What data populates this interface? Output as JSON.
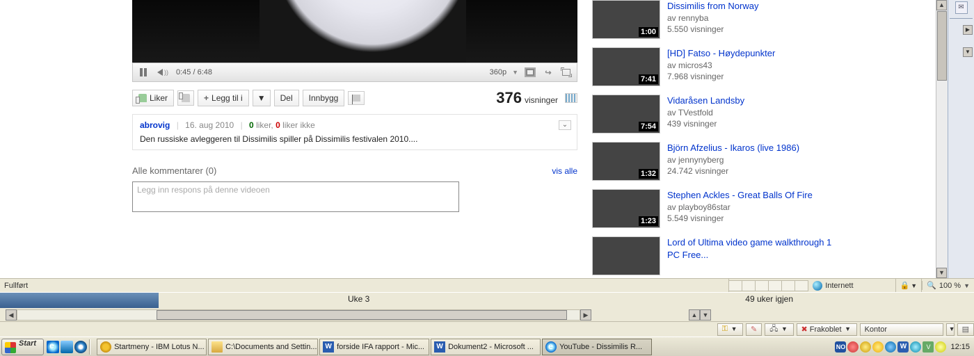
{
  "player": {
    "time": "0:45 / 6:48",
    "quality": "360p"
  },
  "actions": {
    "like": "Liker",
    "add": "Legg til i",
    "share": "Del",
    "embed": "Innbygg"
  },
  "views": {
    "count": "376",
    "label": "visninger"
  },
  "description": {
    "uploader": "abrovig",
    "date": "16. aug 2010",
    "likes_n": "0",
    "likes_lbl": "liker,",
    "dislikes_n": "0",
    "dislikes_lbl": "liker ikke",
    "text": "Den russiske avleggeren til Dissimilis spiller på Dissimilis festivalen 2010...."
  },
  "comments": {
    "header": "Alle kommentarer (0)",
    "showall": "vis alle",
    "placeholder": "Legg inn respons på denne videoen"
  },
  "related": [
    {
      "title": "Dissimilis from Norway",
      "by": "av rennyba",
      "views": "5.550 visninger",
      "dur": "1:00"
    },
    {
      "title": "[HD] Fatso - Høydepunkter",
      "by": "av micros43",
      "views": "7.968 visninger",
      "dur": "7:41"
    },
    {
      "title": "Vidaråsen Landsby",
      "by": "av TVestfold",
      "views": "439 visninger",
      "dur": "7:54"
    },
    {
      "title": "Björn Afzelius - Ikaros (live 1986)",
      "by": "av jennynyberg",
      "views": "24.742 visninger",
      "dur": "1:32"
    },
    {
      "title": "Stephen Ackles - Great Balls Of Fire",
      "by": "av playboy86star",
      "views": "5.549 visninger",
      "dur": "1:23"
    },
    {
      "title": "Lord of Ultima video game walkthrough 1 PC Free...",
      "by": "",
      "views": "",
      "dur": ""
    }
  ],
  "statusbar": {
    "done": "Fullført",
    "zone": "Internett",
    "zoom": "100 %"
  },
  "weekbar": {
    "current": "Uke 3",
    "remaining": "49 uker igjen"
  },
  "lotusbar": {
    "offline": "Frakoblet",
    "location": "Kontor"
  },
  "taskbar": {
    "start": "Start",
    "tasks": [
      "Startmeny - IBM Lotus N...",
      "C:\\Documents and Settin...",
      "forside IFA rapport - Mic...",
      "Dokument2 - Microsoft ...",
      "YouTube - Dissimilis R..."
    ],
    "clock": "12:15"
  }
}
